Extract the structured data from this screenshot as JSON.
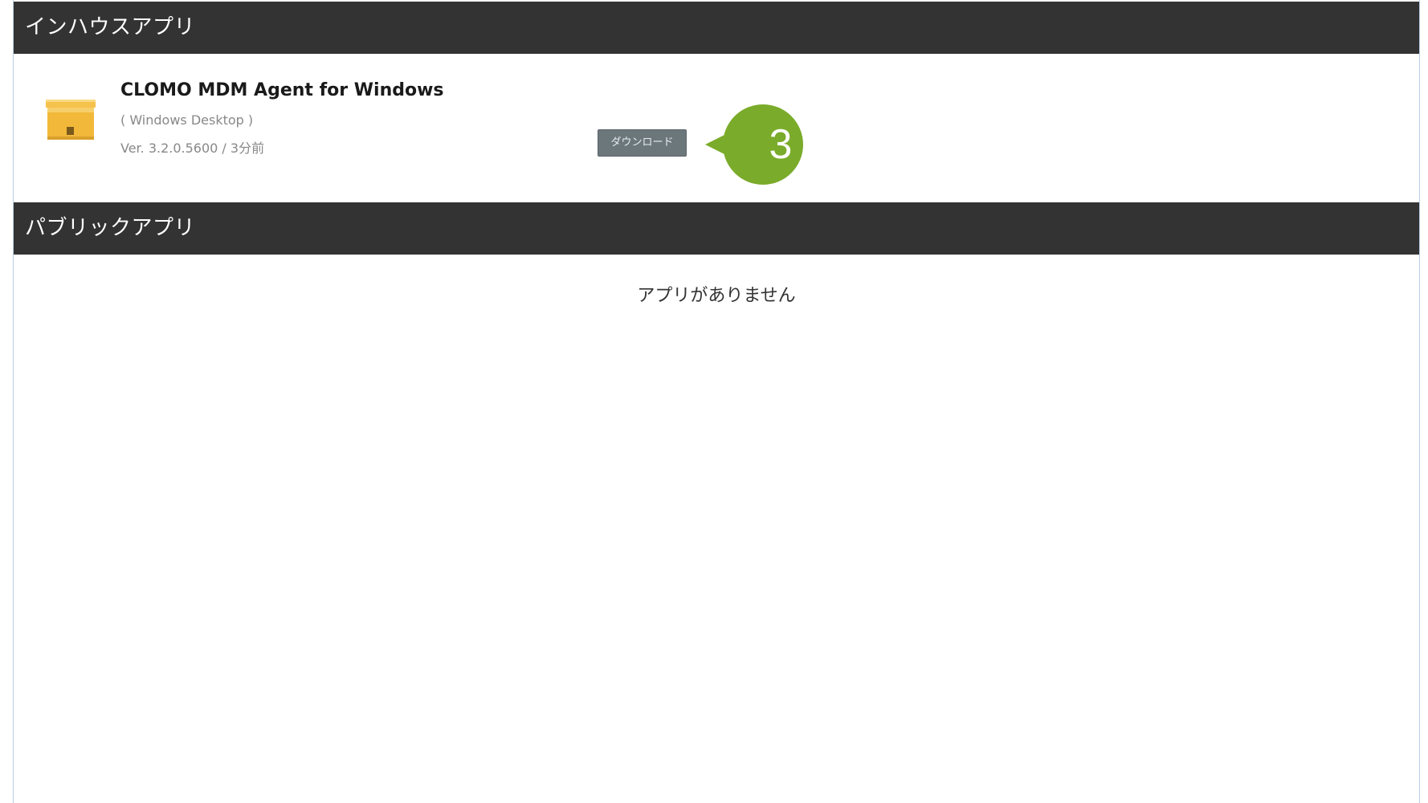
{
  "sections": {
    "inhouse": {
      "title": "インハウスアプリ",
      "apps": [
        {
          "name": "CLOMO MDM Agent for Windows",
          "platform": "( Windows Desktop )",
          "version": "Ver. 3.2.0.5600 / 3分前",
          "icon": "package-box-icon",
          "download_label": "ダウンロード"
        }
      ]
    },
    "public": {
      "title": "パブリックアプリ",
      "empty_message": "アプリがありません"
    }
  },
  "callout": {
    "number": "3",
    "color": "#7aab2a"
  },
  "colors": {
    "header_bg": "#333333",
    "button_bg": "#6c777c",
    "icon_primary": "#f2b83a"
  }
}
